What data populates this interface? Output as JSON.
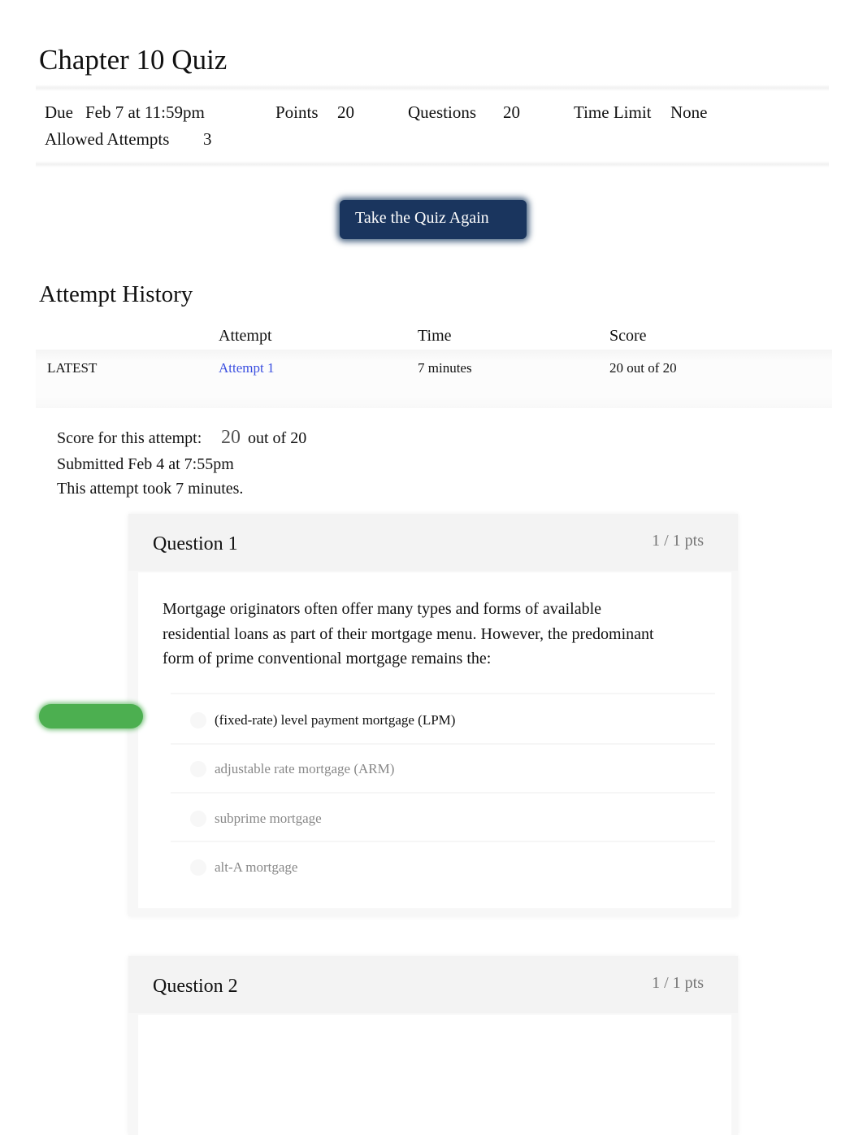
{
  "title": "Chapter 10 Quiz",
  "meta": {
    "due_label": "Due",
    "due": "Feb 7 at 11:59pm",
    "points_label": "Points",
    "points": "20",
    "questions_label": "Questions",
    "questions": "20",
    "time_limit_label": "Time Limit",
    "time_limit": "None",
    "attempts_label": "Allowed Attempts",
    "attempts": "3"
  },
  "take_again": "Take the Quiz Again",
  "history": {
    "title": "Attempt History",
    "headers": [
      "Attempt",
      "Time",
      "Score"
    ],
    "row": {
      "tag": "LATEST",
      "attempt": "Attempt 1",
      "time": "7 minutes",
      "score": "20 out of 20"
    }
  },
  "score": {
    "label": "Score for this attempt:",
    "value": "20",
    "out_of": "out of 20",
    "submitted": "Submitted Feb 4 at 7:55pm",
    "took": "This attempt took 7 minutes."
  },
  "questions": [
    {
      "title": "Question 1",
      "pts": "1 / 1 pts",
      "text": "Mortgage originators often offer many types and forms of available residential loans as part of their mortgage menu. However, the predominant form of prime conventional mortgage remains the:",
      "answers": [
        "(fixed-rate) level payment mortgage (LPM)",
        "adjustable rate mortgage (ARM)",
        "subprime mortgage",
        "alt-A mortgage"
      ],
      "correct_index": 0
    },
    {
      "title": "Question 2",
      "pts": "1 / 1 pts"
    }
  ],
  "colors": {
    "button": "#1a355e",
    "link": "#3b4fe0",
    "correct": "#4caf50"
  }
}
